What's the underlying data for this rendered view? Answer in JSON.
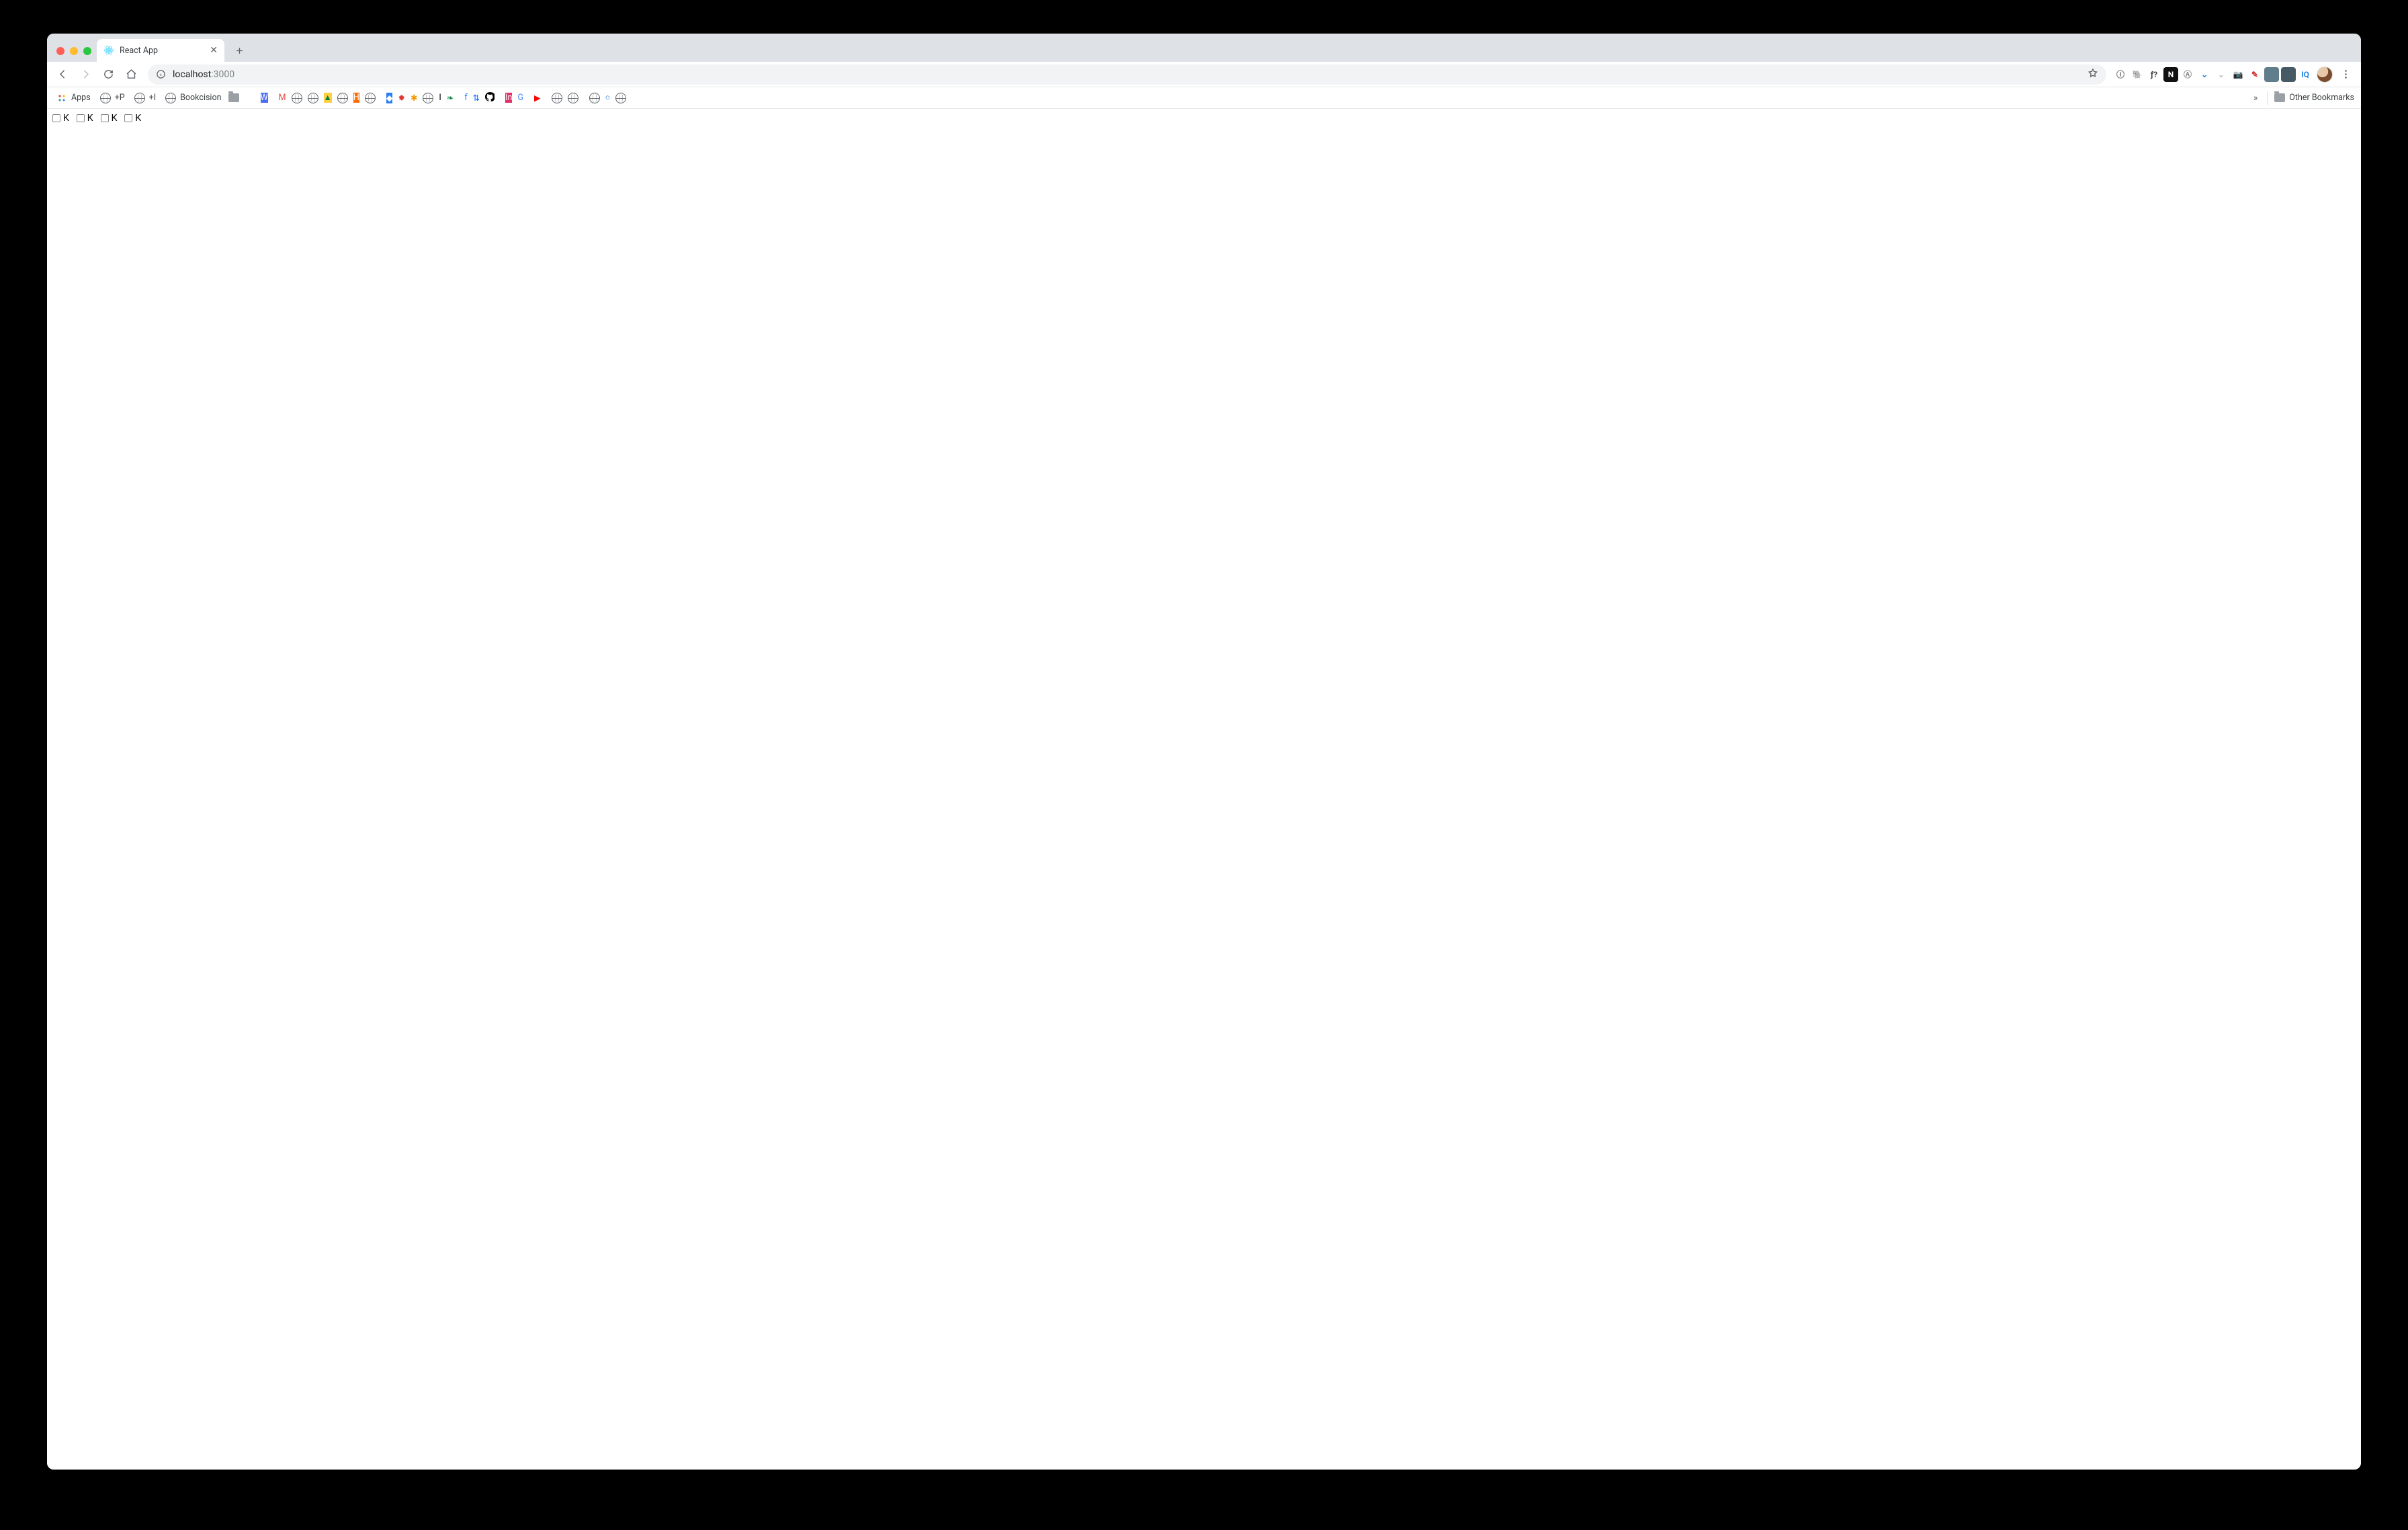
{
  "tab": {
    "title": "React App"
  },
  "url": {
    "host": "localhost",
    "path": ":3000"
  },
  "apps_label": "Apps",
  "other_bookmarks_label": "Other Bookmarks",
  "bookmarks": [
    {
      "label": "+P",
      "kind": "globe"
    },
    {
      "label": "+I",
      "kind": "globe"
    },
    {
      "label": "Bookcision",
      "kind": "globe"
    }
  ],
  "bm_icons": [
    {
      "bg": "#9aa0a6",
      "kind": "folder"
    },
    {
      "bg": "#1a73e8",
      "txt": ""
    },
    {
      "bg": "#111111",
      "txt": ""
    },
    {
      "bg": "#f7b500",
      "txt": ""
    },
    {
      "bg": "#4a6cf7",
      "txt": "W"
    },
    {
      "bg": "#0b9d58",
      "txt": ""
    },
    {
      "bg": "#ffffff",
      "txt": "M",
      "fg": "#ea4335"
    },
    {
      "bg": "#ffffff",
      "kind": "globe"
    },
    {
      "bg": "#ffffff",
      "kind": "globe"
    },
    {
      "bg": "#ffcf43",
      "txt": "▲",
      "fg": "#0b8043"
    },
    {
      "bg": "#ffffff",
      "kind": "globe"
    },
    {
      "bg": "#ff6a00",
      "txt": "H"
    },
    {
      "bg": "#ffffff",
      "kind": "globe"
    },
    {
      "bg": "#4b2fbf",
      "txt": ""
    },
    {
      "bg": "#2e7cf6",
      "txt": "◆"
    },
    {
      "bg": "#ffffff",
      "txt": "✹",
      "fg": "#d33"
    },
    {
      "bg": "#ffffff",
      "txt": "✱",
      "fg": "#f29900"
    },
    {
      "bg": "#ffffff",
      "kind": "globe"
    },
    {
      "bg": "#ffffff",
      "txt": "I",
      "fg": "#000"
    },
    {
      "bg": "#ffffff",
      "txt": "❧",
      "fg": "#0b8043"
    },
    {
      "bg": "#d32f2f",
      "txt": ""
    },
    {
      "bg": "#ffffff",
      "txt": "f",
      "fg": "#1877f2"
    },
    {
      "bg": "#ffffff",
      "txt": "⇅",
      "fg": "#0061ff"
    },
    {
      "bg": "#ffffff",
      "txt": "",
      "fg": "#000",
      "kind": "github"
    },
    {
      "bg": "#2196f3",
      "txt": ""
    },
    {
      "bg": "#e1306c",
      "txt": "In"
    },
    {
      "bg": "#ffffff",
      "txt": "G",
      "fg": "#4285f4"
    },
    {
      "bg": "#e0e0e0",
      "txt": ""
    },
    {
      "bg": "#ffffff",
      "txt": "▶",
      "fg": "#ff0000"
    },
    {
      "bg": "#8b0000",
      "txt": ""
    },
    {
      "bg": "#ffffff",
      "kind": "globe"
    },
    {
      "bg": "#ffffff",
      "kind": "globe"
    },
    {
      "bg": "#7fdfff",
      "txt": ""
    },
    {
      "bg": "#ffffff",
      "kind": "globe"
    },
    {
      "bg": "#ffffff",
      "txt": "○",
      "fg": "#0366d6"
    },
    {
      "bg": "#ffffff",
      "kind": "globe"
    }
  ],
  "extensions": [
    {
      "bg": "transparent",
      "txt": "ⓘ",
      "fg": "#5f6368"
    },
    {
      "bg": "transparent",
      "txt": "🐘",
      "fg": "#00a82d"
    },
    {
      "bg": "transparent",
      "txt": "ƒ?",
      "fg": "#444"
    },
    {
      "bg": "#111",
      "txt": "N"
    },
    {
      "bg": "transparent",
      "txt": "Ⓐ",
      "fg": "#888"
    },
    {
      "bg": "transparent",
      "txt": "⌄",
      "fg": "#1e88e5"
    },
    {
      "bg": "transparent",
      "txt": "⌄",
      "fg": "#bdbdbd"
    },
    {
      "bg": "transparent",
      "txt": "📷",
      "fg": "#888"
    },
    {
      "bg": "transparent",
      "txt": "✎",
      "fg": "#d32f2f"
    },
    {
      "bg": "#607d8b",
      "txt": ""
    },
    {
      "bg": "#455a64",
      "txt": ""
    },
    {
      "bg": "transparent",
      "txt": "IQ",
      "fg": "#1e88e5"
    }
  ],
  "content_items": [
    {
      "label": "K"
    },
    {
      "label": "K"
    },
    {
      "label": "K"
    },
    {
      "label": "K"
    }
  ]
}
